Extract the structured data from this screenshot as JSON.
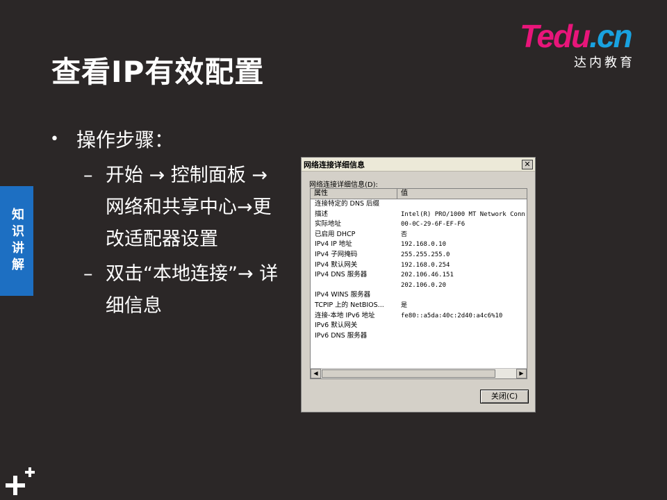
{
  "slide": {
    "title": "查看IP有效配置",
    "side_tab": "知识讲解",
    "bullet_main": "操作步骤：",
    "bullet_sub1": "开始 → 控制面板 → 网络和共享中心→更改适配器设置",
    "bullet_sub2": "双击“本地连接”→ 详细信息",
    "bullet_mark": "•",
    "dash_mark": "–"
  },
  "logo": {
    "t": "T",
    "edu": "edu",
    "dotcn": ".cn",
    "sub": "达内教育"
  },
  "dialog": {
    "title": "网络连接详细信息",
    "close_glyph": "✕",
    "list_label": "网络连接详细信息(D):",
    "col_property": "属性",
    "col_value": "值",
    "rows": [
      {
        "p": "连接特定的 DNS 后缀",
        "v": ""
      },
      {
        "p": "描述",
        "v": "Intel(R) PRO/1000 MT Network Conn"
      },
      {
        "p": "实际地址",
        "v": "00-0C-29-6F-EF-F6"
      },
      {
        "p": "已启用 DHCP",
        "v": "否"
      },
      {
        "p": "IPv4 IP 地址",
        "v": "192.168.0.10"
      },
      {
        "p": "IPv4 子网掩码",
        "v": "255.255.255.0"
      },
      {
        "p": "IPv4 默认网关",
        "v": "192.168.0.254"
      },
      {
        "p": "IPv4 DNS 服务器",
        "v": "202.106.46.151"
      },
      {
        "p": "",
        "v": "202.106.0.20"
      },
      {
        "p": "IPv4 WINS 服务器",
        "v": ""
      },
      {
        "p": "TCPIP 上的 NetBIOS...",
        "v": "是"
      },
      {
        "p": "连接-本地 IPv6 地址",
        "v": "fe80::a5da:40c:2d40:a4c6%10"
      },
      {
        "p": "IPv6 默认网关",
        "v": ""
      },
      {
        "p": "IPv6 DNS 服务器",
        "v": ""
      }
    ],
    "scroll_left": "◀",
    "scroll_right": "▶",
    "close_button": "关闭(C)"
  },
  "colors": {
    "background": "#2b2727",
    "side_tab": "#1d6fc2",
    "logo_pink": "#e8157a",
    "logo_blue": "#19a2e0"
  }
}
